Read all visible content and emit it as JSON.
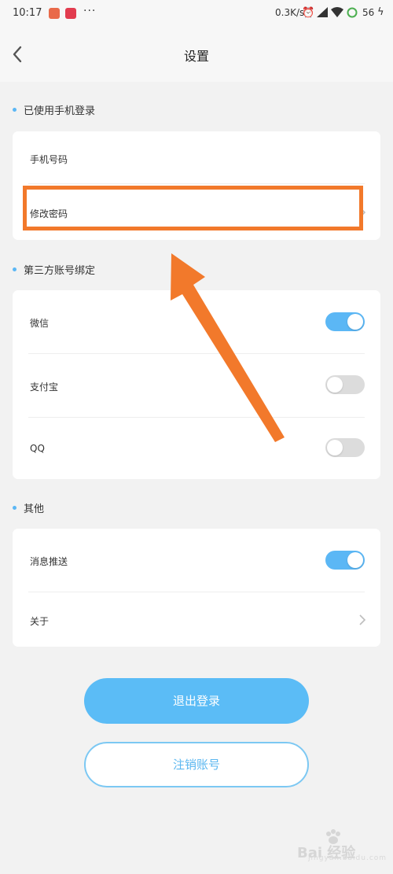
{
  "status_bar": {
    "time": "10:17",
    "more": "···",
    "net_speed": "0.3K/s",
    "battery": "56",
    "icons": [
      "alarm-icon",
      "signal-icon",
      "wifi-icon",
      "battery-icon",
      "charging-icon"
    ]
  },
  "header": {
    "title": "设置",
    "back_icon": "chevron-left-icon"
  },
  "sections": {
    "login": {
      "label": "已使用手机登录",
      "items": [
        {
          "label": "手机号码"
        },
        {
          "label": "修改密码",
          "has_chevron": true
        }
      ]
    },
    "third_party": {
      "label": "第三方账号绑定",
      "items": [
        {
          "label": "微信",
          "toggle": true
        },
        {
          "label": "支付宝",
          "toggle": false
        },
        {
          "label": "QQ",
          "toggle": false
        }
      ]
    },
    "other": {
      "label": "其他",
      "items": [
        {
          "label": "消息推送",
          "toggle": true
        },
        {
          "label": "关于",
          "has_chevron": true
        }
      ]
    }
  },
  "buttons": {
    "logout": "退出登录",
    "cancel_account": "注销账号"
  },
  "colors": {
    "accent": "#5bb7f5",
    "annotation": "#f2792b",
    "toggle_off": "#dcdcdc"
  },
  "watermark": {
    "text": "Bai 经验",
    "sub": "jingyan.baidu.com"
  }
}
